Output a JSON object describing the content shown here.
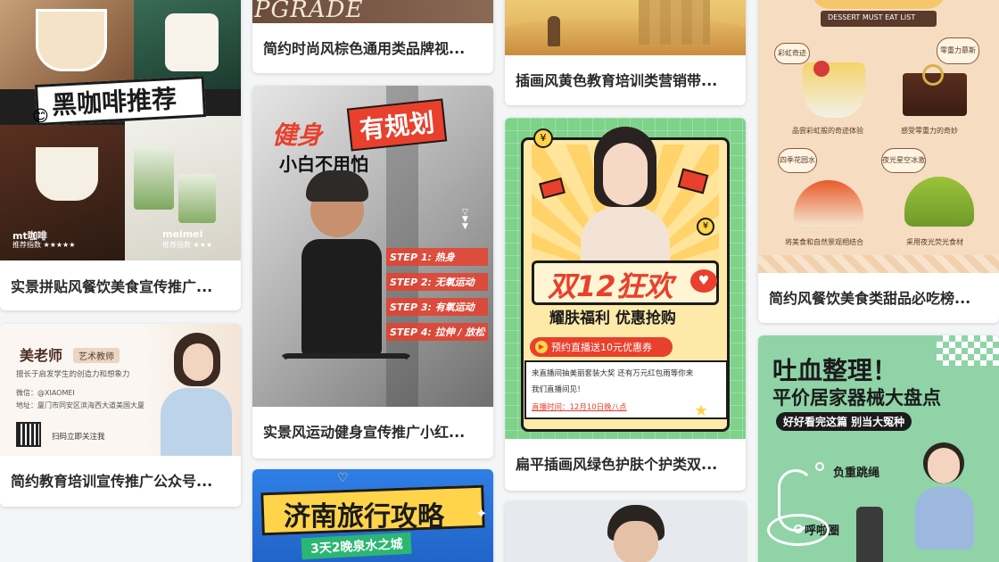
{
  "cards": {
    "coffee": {
      "title": "实景拼贴风餐饮美食宣传推广...",
      "poster_title": "黑咖啡推荐",
      "label1": "mt咖啡",
      "sub1": "推荐指数 ★★★★★",
      "label2": "meimei",
      "sub2": "推荐指数 ★★★"
    },
    "education": {
      "title": "简约教育培训宣传推广公众号...",
      "teacher": "美老师",
      "role": "艺术教师",
      "desc": "擅长于启发学生的创造力和想象力",
      "wechat": "微信：@XIAOMEI",
      "address": "地址：厦门市同安区滨海西大道美国大厦",
      "scan": "扫码立即关注我"
    },
    "brand": {
      "title": "简约时尚风棕色通用类品牌视...",
      "banner": "PGRADE"
    },
    "fitness": {
      "title": "实景风运动健身宣传推广小红...",
      "head1": "健身",
      "head2": "有规划",
      "head3": "小白不用怕",
      "steps": [
        "STEP 1: 热身",
        "STEP 2: 无氧运动",
        "STEP 3: 有氧运动",
        "STEP 4: 拉伸 / 放松"
      ]
    },
    "travel": {
      "title": "济南旅行攻略",
      "subtitle": "3天2晚泉水之城"
    },
    "edu_yellow": {
      "title": "插画风黄色教育培训类营销带..."
    },
    "skincare": {
      "title": "扁平插画风绿色护肤个护类双...",
      "headline": "双12狂欢",
      "sub": "耀肤福利 优惠抢购",
      "pill": "预约直播送10元优惠券",
      "body1": "来直播间抽美丽套装大奖   还有万元红包雨等你来",
      "body2": "我们直播间见！",
      "time": "直播时间：12月10日晚八点"
    },
    "dessert": {
      "title": "简约风餐饮美食类甜品必吃榜...",
      "ribbon": "DESSERT MUST EAT LIST",
      "items": [
        {
          "tag": "彩虹奇迹杯",
          "caption": "品尝彩虹般的奇迹体验"
        },
        {
          "tag": "零重力慕斯球",
          "caption": "感受零重力的奇妙"
        },
        {
          "tag": "四季花园水果塔",
          "caption": "将美食和自然景观相结合"
        },
        {
          "tag": "夜光星空冰激凌",
          "caption": "采用夜光荧光食材"
        }
      ]
    },
    "equipment": {
      "line1": "吐血整理！",
      "line2": "平价居家器械大盘点",
      "tagline": "好好看完这篇 别当大冤种",
      "tag1": "负重跳绳",
      "tag2": "呼啦圈"
    }
  },
  "colors": {
    "accent_red": "#e8402d",
    "brand_brown": "#6b4b3a",
    "skincare_green": "#7ed28a",
    "dessert_bg": "#f6dcc0",
    "equipment_green": "#8fd3a7"
  }
}
